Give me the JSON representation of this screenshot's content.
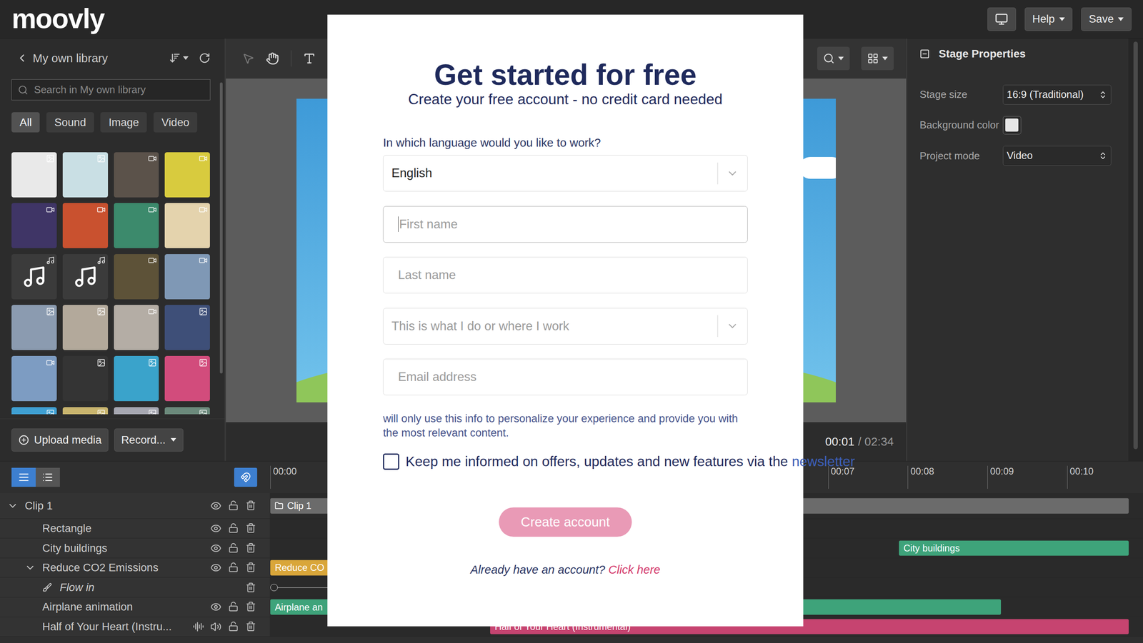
{
  "top_bar": {
    "logo": "moovly",
    "buttons": [
      "Help",
      "Save"
    ]
  },
  "library": {
    "title": "My own library",
    "search_placeholder": "Search in My own library",
    "filters": [
      {
        "label": "All",
        "selected": true
      },
      {
        "label": "Sound",
        "selected": false
      },
      {
        "label": "Image",
        "selected": false
      },
      {
        "label": "Video",
        "selected": false
      }
    ],
    "items": [
      {
        "kind": "image",
        "color": "#e9e9e9"
      },
      {
        "kind": "image",
        "color": "#c9dfe4"
      },
      {
        "kind": "video",
        "color": "#5b524a"
      },
      {
        "kind": "video",
        "color": "#d8cb3e"
      },
      {
        "kind": "video",
        "color": "#3f3566"
      },
      {
        "kind": "video",
        "color": "#c9512f"
      },
      {
        "kind": "video",
        "color": "#3c8a6c"
      },
      {
        "kind": "video",
        "color": "#e4d3ad"
      },
      {
        "kind": "sound",
        "color": "#3b3b3b"
      },
      {
        "kind": "sound",
        "color": "#3b3b3b"
      },
      {
        "kind": "video",
        "color": "#5d5238"
      },
      {
        "kind": "video",
        "color": "#7f98b5"
      },
      {
        "kind": "image",
        "color": "#8b9bb0"
      },
      {
        "kind": "image",
        "color": "#b3a99b"
      },
      {
        "kind": "video",
        "color": "#b4ada5"
      },
      {
        "kind": "image",
        "color": "#3e4f78"
      },
      {
        "kind": "video",
        "color": "#7d9cc2"
      },
      {
        "kind": "image",
        "color": "#343434"
      },
      {
        "kind": "image",
        "color": "#3aa3cb"
      },
      {
        "kind": "image",
        "color": "#d24c7c"
      },
      {
        "kind": "image",
        "color": "#3fa0d3"
      },
      {
        "kind": "image",
        "color": "#c9b56e"
      },
      {
        "kind": "image",
        "color": "#a7a8b2"
      },
      {
        "kind": "image",
        "color": "#6c8a7c"
      }
    ],
    "upload": "Upload media",
    "record": "Record..."
  },
  "stage": {
    "current_time": "00:01",
    "separator": "/",
    "total_time": "02:34"
  },
  "properties": {
    "title": "Stage Properties",
    "fields": [
      {
        "label": "Stage size",
        "kind": "select",
        "value": "16:9 (Traditional)"
      },
      {
        "label": "Background color",
        "kind": "color",
        "color": "#e6e6e6"
      },
      {
        "label": "Project mode",
        "kind": "select",
        "value": "Video"
      }
    ]
  },
  "timeline": {
    "ruler": [
      "00:00",
      "00:07",
      "00:08",
      "00:09",
      "00:10"
    ],
    "view_buttons": [
      {
        "selected": true
      },
      {
        "selected": false
      }
    ],
    "tracks": [
      {
        "name": "Clip 1",
        "depth": 0,
        "kind": "clip",
        "expanded": true,
        "bar": {
          "label": "Clip 1",
          "start": 0,
          "end": 10.77,
          "color": "#6b6b6b"
        }
      },
      {
        "name": "Rectangle",
        "depth": 1,
        "kind": "layer"
      },
      {
        "name": "City buildings",
        "depth": 1,
        "kind": "layer",
        "bar": {
          "label": "City buildings",
          "start": 7.89,
          "end": 10.77,
          "color": "#3ea37a"
        }
      },
      {
        "name": "Reduce CO2 Emissions",
        "depth": 1,
        "kind": "group",
        "expanded": true,
        "bar": {
          "label": "Reduce CO",
          "start": 0,
          "end": 6,
          "color": "#d9a63a"
        }
      },
      {
        "name": "Flow in",
        "depth": 2,
        "kind": "effect",
        "effect": {
          "start": 0,
          "end": 6
        }
      },
      {
        "name": "Airplane animation",
        "depth": 1,
        "kind": "layer",
        "bar": {
          "label": "Airplane an",
          "start": 0,
          "end": 9.17,
          "color": "#3ea37a"
        }
      },
      {
        "name": "Half of Your Heart (Instru...",
        "depth": 1,
        "kind": "audio",
        "bar": {
          "label": "Half of Your Heart (Instrumental)",
          "start": 2.76,
          "end": 10.77,
          "color": "#c64470"
        }
      }
    ]
  },
  "signup": {
    "title": "Get started for free",
    "subtitle": "Create your free account - no credit card needed",
    "language_label": "In which language would you like to work?",
    "fields": [
      {
        "kind": "select",
        "text": "English",
        "filled": true,
        "focused": false
      },
      {
        "kind": "input",
        "text": "First name",
        "filled": false,
        "focused": true
      },
      {
        "kind": "input",
        "text": "Last name",
        "filled": false,
        "focused": false
      },
      {
        "kind": "select",
        "text": "This is what I do or where I work",
        "filled": false,
        "focused": false
      },
      {
        "kind": "input",
        "text": "Email address",
        "filled": false,
        "focused": false
      }
    ],
    "note": "will only use this info to personalize your experience and provide you with the most relevant content.",
    "newsletter": {
      "text": "Keep me informed on offers, updates and new features via the",
      "link": "newsletter",
      "checked": false
    },
    "button": "Create account",
    "login": {
      "text": "Already have an account?",
      "link": "Click here"
    }
  }
}
